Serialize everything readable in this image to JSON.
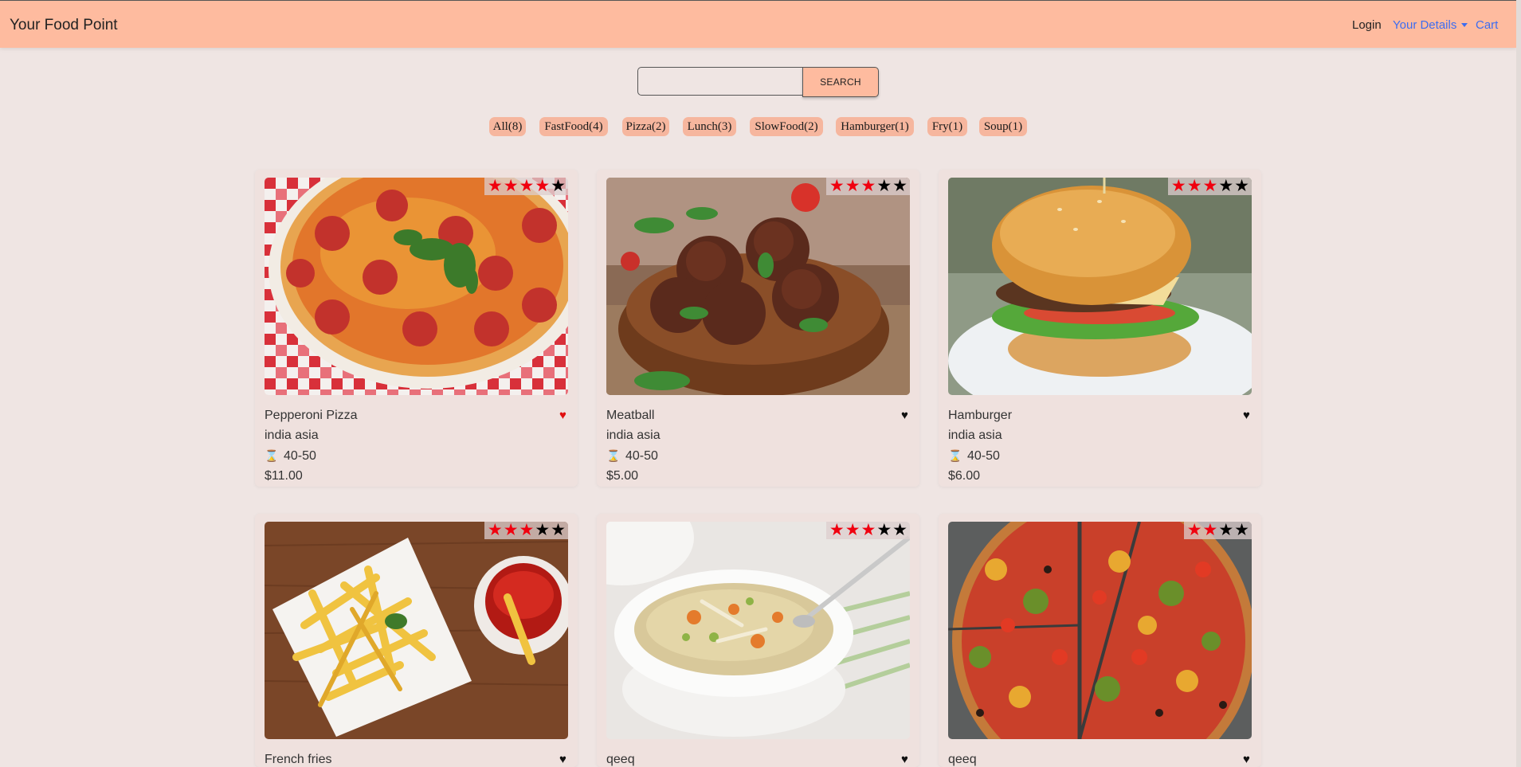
{
  "navbar": {
    "brand": "Your Food Point",
    "login": "Login",
    "details": "Your Details",
    "cart": "Cart"
  },
  "search": {
    "value": "",
    "placeholder": "",
    "button": "SEARCH"
  },
  "categories": [
    "All(8)",
    "FastFood(4)",
    "Pizza(2)",
    "Lunch(3)",
    "SlowFood(2)",
    "Hamburger(1)",
    "Fry(1)",
    "Soup(1)"
  ],
  "items": [
    {
      "name": "Pepperoni Pizza",
      "origin": "india asia",
      "time": "40-50",
      "price": "$11.00",
      "rating": 4,
      "favorite": true,
      "image": "pepperoni-pizza-image"
    },
    {
      "name": "Meatball",
      "origin": "india asia",
      "time": "40-50",
      "price": "$5.00",
      "rating": 3,
      "favorite": false,
      "image": "meatball-image"
    },
    {
      "name": "Hamburger",
      "origin": "india asia",
      "time": "40-50",
      "price": "$6.00",
      "rating": 3,
      "favorite": false,
      "image": "hamburger-image"
    },
    {
      "name": "French fries",
      "rating": 3,
      "favorite": false,
      "image": "french-fries-image"
    },
    {
      "name": "qeeq",
      "rating": 3,
      "favorite": false,
      "image": "soup-image"
    },
    {
      "name": "qeeq",
      "rating": 2,
      "favorite": false,
      "image": "veggie-pizza-image"
    }
  ],
  "icons": {
    "star": "star-icon",
    "heart": "heart-icon",
    "hourglass": "hourglass-icon",
    "caret": "caret-down-icon"
  },
  "colors": {
    "navbar": "#febb9f",
    "background": "#efe5e3",
    "link": "#3d6df0",
    "star_on": "#f0000f",
    "heart_favorite": "#e01010"
  }
}
